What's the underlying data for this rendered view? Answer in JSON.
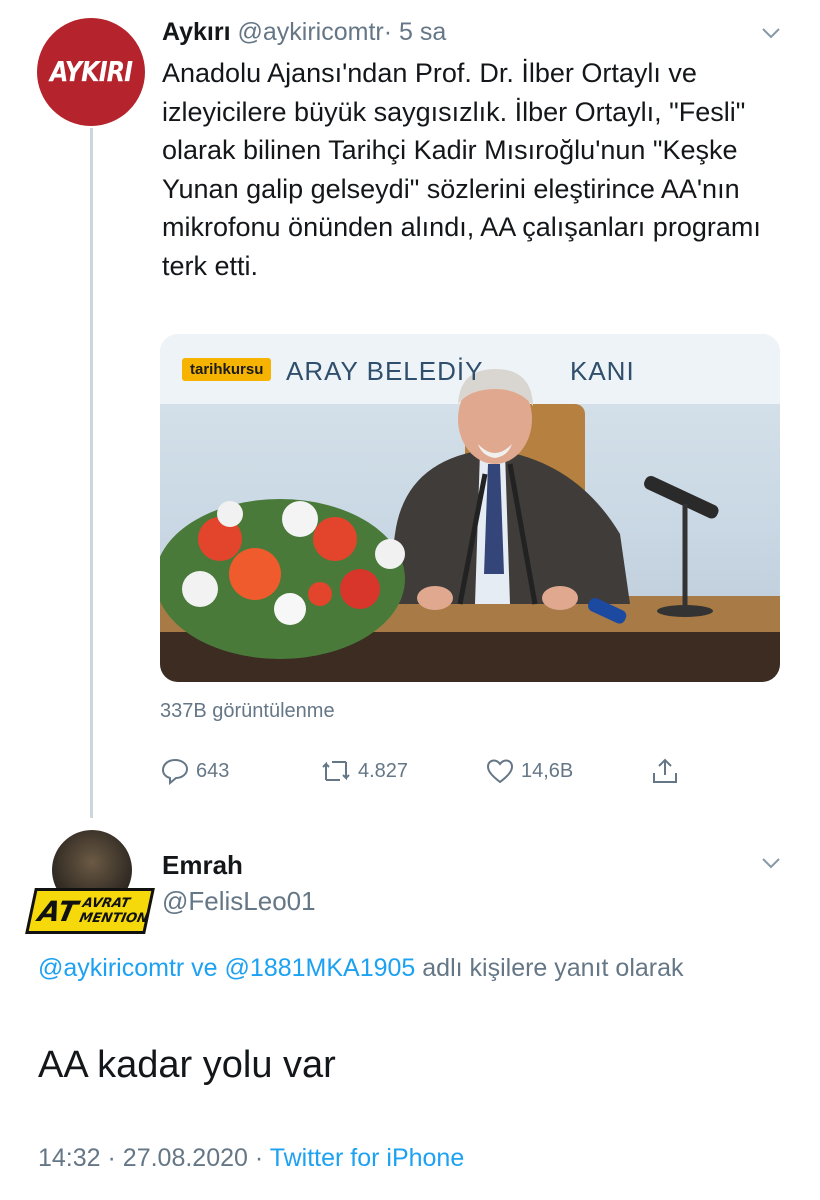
{
  "tweet": {
    "avatar_text": "AYKIRI",
    "name": "Aykırı",
    "handle": "@aykiricomtr",
    "separator": "·",
    "time": "5 sa",
    "text": "Anadolu Ajansı'ndan Prof. Dr. İlber Ortaylı ve izleyicilere büyük saygısızlık. İlber Ortaylı, \"Fesli\" olarak bilinen Tarihçi Kadir Mısıroğlu'nun \"Keşke Yunan galip gelseydi\" sözlerini eleştirince AA'nın mikrofonu önünden alındı, AA çalışanları programı terk etti.",
    "media": {
      "tag": "tarihkursu",
      "banner_left": "ARAY BELEDİY",
      "banner_right": "KANI"
    },
    "views": "337B görüntülenme",
    "actions": {
      "reply_count": "643",
      "retweet_count": "4.827",
      "like_count": "14,6B"
    }
  },
  "reply": {
    "name": "Emrah",
    "handle": "@FelisLeo01",
    "badge": {
      "big": "AT",
      "line1": "AVRAT",
      "line2": "MENTION"
    },
    "replying_mention1": "@aykiricomtr",
    "replying_and": "ve",
    "replying_mention2": "@1881MKA1905",
    "replying_suffix": "adlı kişilere yanıt olarak",
    "text": "AA kadar yolu var",
    "time": "14:32",
    "separator": "·",
    "date": "27.08.2020",
    "separator2": "·",
    "source": "Twitter for iPhone"
  },
  "colors": {
    "accent": "#1da1f2",
    "muted": "#657786",
    "brand": "#b5232c"
  }
}
